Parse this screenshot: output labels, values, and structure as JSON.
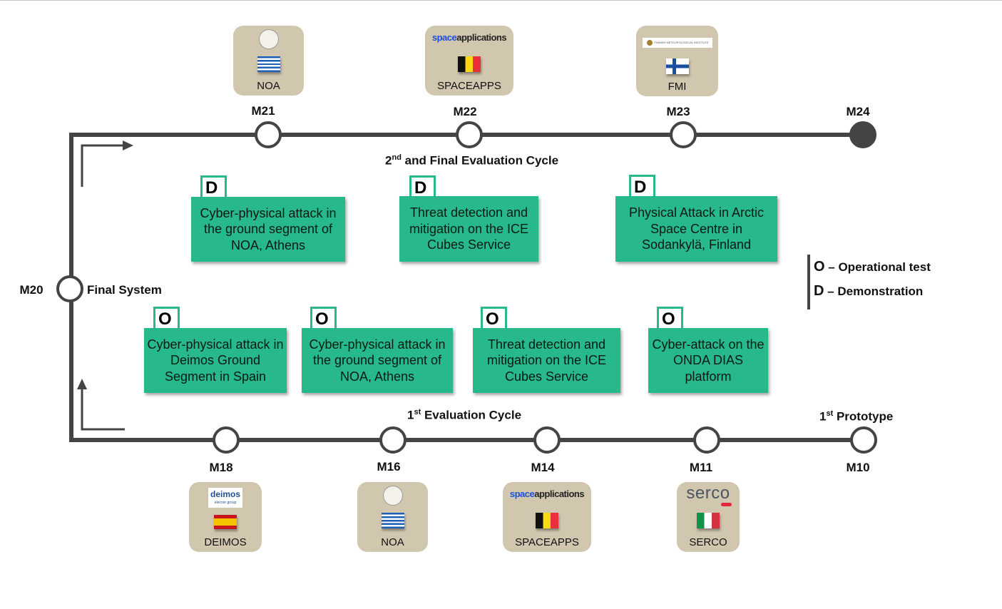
{
  "milestones_top": [
    "M21",
    "M22",
    "M23",
    "M24"
  ],
  "milestones_bottom": [
    "M18",
    "M16",
    "M14",
    "M11",
    "M10"
  ],
  "m20": "M20",
  "final_system": "Final System",
  "cycle2": {
    "sup": "nd",
    "pre": "2",
    "text": " and Final Evaluation Cycle"
  },
  "cycle1": {
    "sup": "st",
    "pre": "1",
    "text": " Evaluation Cycle"
  },
  "prototype": {
    "sup": "st",
    "pre": "1",
    "text": " Prototype"
  },
  "demos": [
    {
      "tag": "D",
      "text": "Cyber-physical attack in the ground segment of NOA, Athens"
    },
    {
      "tag": "D",
      "text": "Threat detection and mitigation on the ICE Cubes Service"
    },
    {
      "tag": "D",
      "text": "Physical Attack in Arctic Space Centre in Sodankylä, Finland"
    }
  ],
  "ops": [
    {
      "tag": "O",
      "text": "Cyber-physical attack in Deimos Ground Segment in Spain"
    },
    {
      "tag": "O",
      "text": "Cyber-physical attack in the ground segment of NOA, Athens"
    },
    {
      "tag": "O",
      "text": "Threat detection and mitigation on the ICE Cubes Service"
    },
    {
      "tag": "O",
      "text": "Cyber-attack on the ONDA DIAS platform"
    }
  ],
  "orgs_top": [
    {
      "name": "NOA",
      "flag": "greece"
    },
    {
      "name": "SPACEAPPS",
      "flag": "belgium",
      "logo": "spaceapplications"
    },
    {
      "name": "FMI",
      "flag": "finland",
      "logo": "FINNISH METEOROLOGICAL INSTITUTE"
    }
  ],
  "orgs_bottom": [
    {
      "name": "DEIMOS",
      "flag": "spain",
      "logo": "deimos",
      "logo_sub": "elecnor group"
    },
    {
      "name": "NOA",
      "flag": "greece"
    },
    {
      "name": "SPACEAPPS",
      "flag": "belgium",
      "logo": "spaceapplications"
    },
    {
      "name": "SERCO",
      "flag": "italy",
      "logo": "serco"
    }
  ],
  "legend": [
    {
      "key": "O",
      "text": " – Operational test"
    },
    {
      "key": "D",
      "text": " – Demonstration"
    }
  ],
  "colors": {
    "card": "#27b98b",
    "line": "#444444",
    "org_box": "#d1c6ae"
  }
}
